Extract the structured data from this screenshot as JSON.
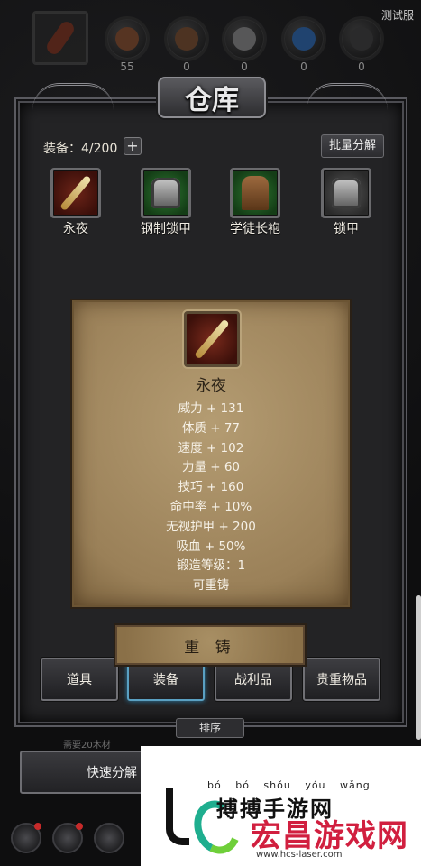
{
  "server_label": "测试服",
  "resources": [
    {
      "icon": "weapon-slot-icon",
      "count": ""
    },
    {
      "icon": "leather-resource-icon",
      "count": "55"
    },
    {
      "icon": "wood-resource-icon",
      "count": "0"
    },
    {
      "icon": "ore-resource-icon",
      "count": "0"
    },
    {
      "icon": "crystal-resource-icon",
      "count": "0"
    },
    {
      "icon": "dark-resource-icon",
      "count": "0"
    }
  ],
  "warehouse": {
    "title": "仓库",
    "equip_count": "装备：4/200",
    "plus_label": "+",
    "bulk_decompose_label": "批量分解"
  },
  "items": [
    {
      "name": "永夜",
      "rarity": "red",
      "icon": "spear-icon"
    },
    {
      "name": "钢制锁甲",
      "rarity": "green",
      "icon": "chest-armor-icon"
    },
    {
      "name": "学徒长袍",
      "rarity": "green",
      "icon": "robe-icon"
    },
    {
      "name": "锁甲",
      "rarity": "gray",
      "icon": "chest-armor-icon"
    }
  ],
  "tooltip": {
    "name": "永夜",
    "stats": [
      "威力 + 131",
      "体质 + 77",
      "速度 + 102",
      "力量 + 60",
      "技巧 + 160",
      "命中率 + 10%",
      "无视护甲 + 200",
      "吸血 + 50%",
      "锻造等级：1",
      "可重铸"
    ],
    "reforge_label": "重 铸"
  },
  "tabs": [
    {
      "label": "道具",
      "active": false
    },
    {
      "label": "装备",
      "active": true
    },
    {
      "label": "战利品",
      "active": false
    },
    {
      "label": "贵重物品",
      "active": false
    }
  ],
  "sort_label": "排序",
  "requirement_text": "需要20木材",
  "quick_decompose_label": "快速分解",
  "watermark": {
    "pinyin": "bó bó shǒu yóu wǎng",
    "brand_line1": "搏搏手游网",
    "brand_line2": "宏昌游戏网",
    "url": "www.hcs-laser.com"
  },
  "colors": {
    "red_rarity": "#6d2418",
    "green_rarity": "#2f7a32",
    "active_tab_glow": "#5aa0c2",
    "parchment": "#a58b61"
  }
}
